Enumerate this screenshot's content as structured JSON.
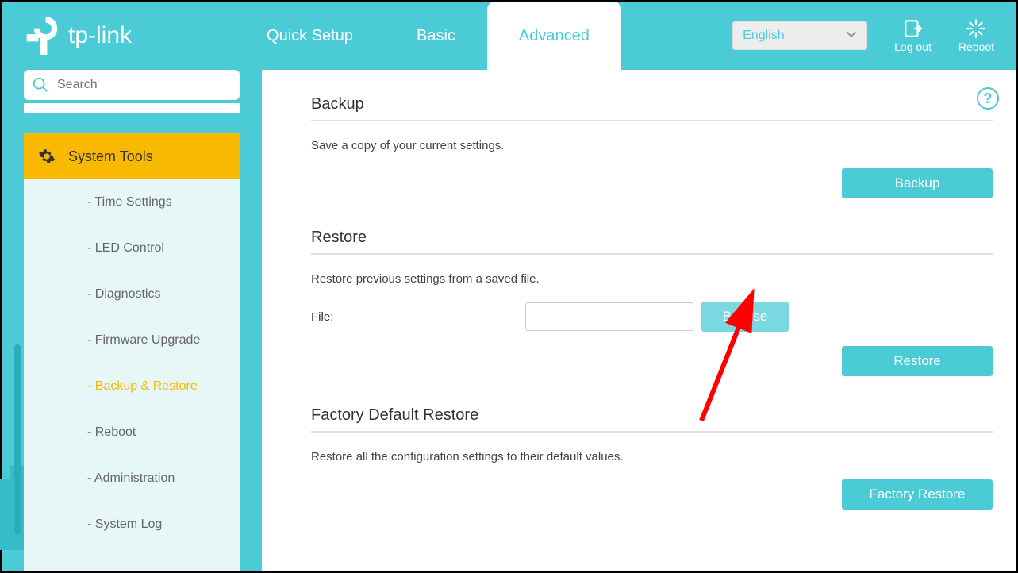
{
  "brand": "tp-link",
  "nav": {
    "tabs": [
      "Quick Setup",
      "Basic",
      "Advanced"
    ],
    "active": "Advanced"
  },
  "language": {
    "selected": "English"
  },
  "top_actions": {
    "logout": "Log out",
    "reboot": "Reboot"
  },
  "search": {
    "placeholder": "Search"
  },
  "sidebar": {
    "title": "System Tools",
    "items": [
      "- Time Settings",
      "- LED Control",
      "- Diagnostics",
      "- Firmware Upgrade",
      "- Backup & Restore",
      "- Reboot",
      "- Administration",
      "- System Log"
    ],
    "active_index": 4
  },
  "content": {
    "backup": {
      "title": "Backup",
      "desc": "Save a copy of your current settings.",
      "button": "Backup"
    },
    "restore": {
      "title": "Restore",
      "desc": "Restore previous settings from a saved file.",
      "file_label": "File:",
      "browse": "Browse",
      "button": "Restore"
    },
    "factory": {
      "title": "Factory Default Restore",
      "desc": "Restore all the configuration settings to their default values.",
      "button": "Factory Restore"
    }
  }
}
